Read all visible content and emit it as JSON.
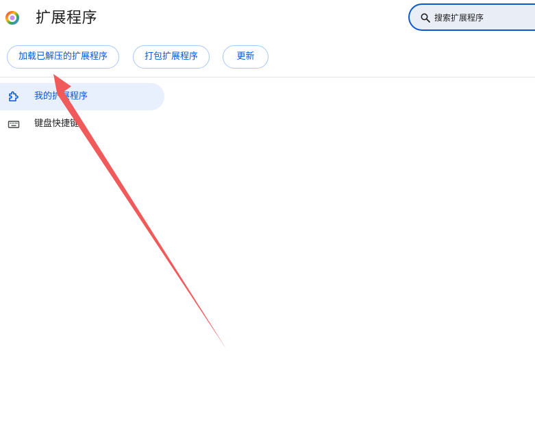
{
  "header": {
    "title": "扩展程序",
    "logo_icon": "chromium-logo-icon"
  },
  "search": {
    "placeholder": "搜索扩展程序",
    "value": "",
    "icon": "search-icon"
  },
  "toolbar": {
    "load_unpacked_label": "加载已解压的扩展程序",
    "pack_label": "打包扩展程序",
    "update_label": "更新"
  },
  "sidebar": {
    "items": [
      {
        "label": "我的扩展程序",
        "icon": "puzzle-piece-icon",
        "active": true
      },
      {
        "label": "键盘快捷键",
        "icon": "keyboard-icon",
        "active": false
      }
    ]
  },
  "colors": {
    "accent": "#0b57d0",
    "button_border": "#a8c7fa",
    "active_item_bg": "#e8f0fe",
    "search_bg": "#e9eef6",
    "annotation_arrow": "#f05a5a"
  }
}
